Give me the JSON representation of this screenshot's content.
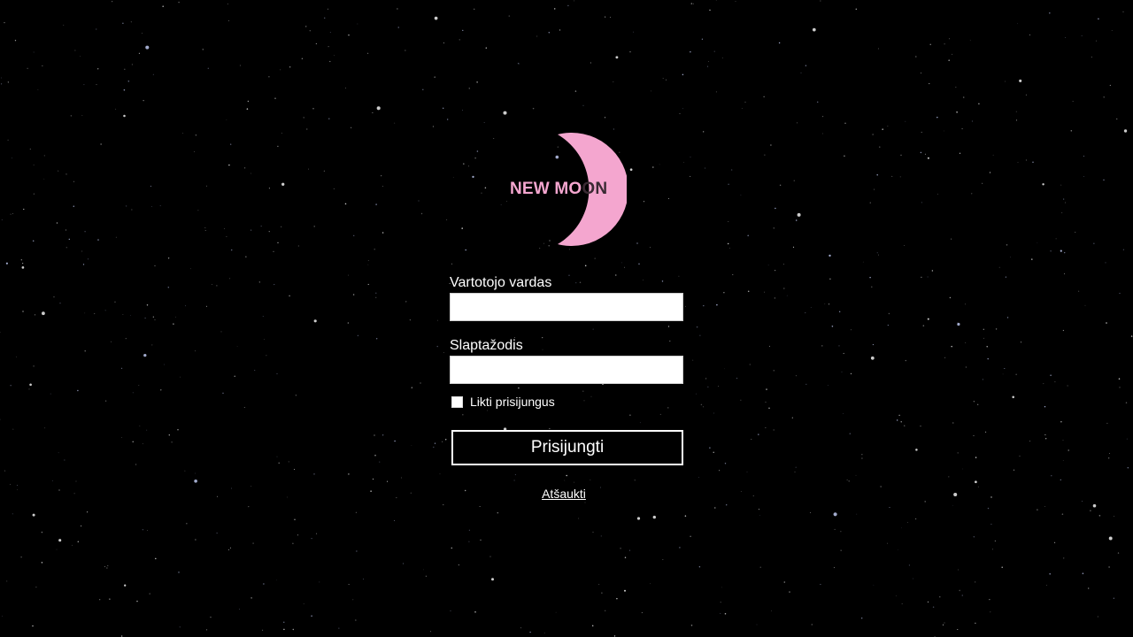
{
  "logo": {
    "text_part1": "NEW MO",
    "text_part2": "ON",
    "icon": "crescent-moon-icon",
    "moon_color": "#f4a6cf"
  },
  "login_form": {
    "username_label": "Vartotojo vardas",
    "username_value": "",
    "password_label": "Slaptažodis",
    "password_value": "",
    "remember_label": "Likti prisijungus",
    "remember_checked": false,
    "submit_label": "Prisijungti",
    "cancel_label": "Atšaukti"
  },
  "colors": {
    "background": "#000000",
    "text": "#ffffff",
    "accent": "#f4a6cf"
  }
}
